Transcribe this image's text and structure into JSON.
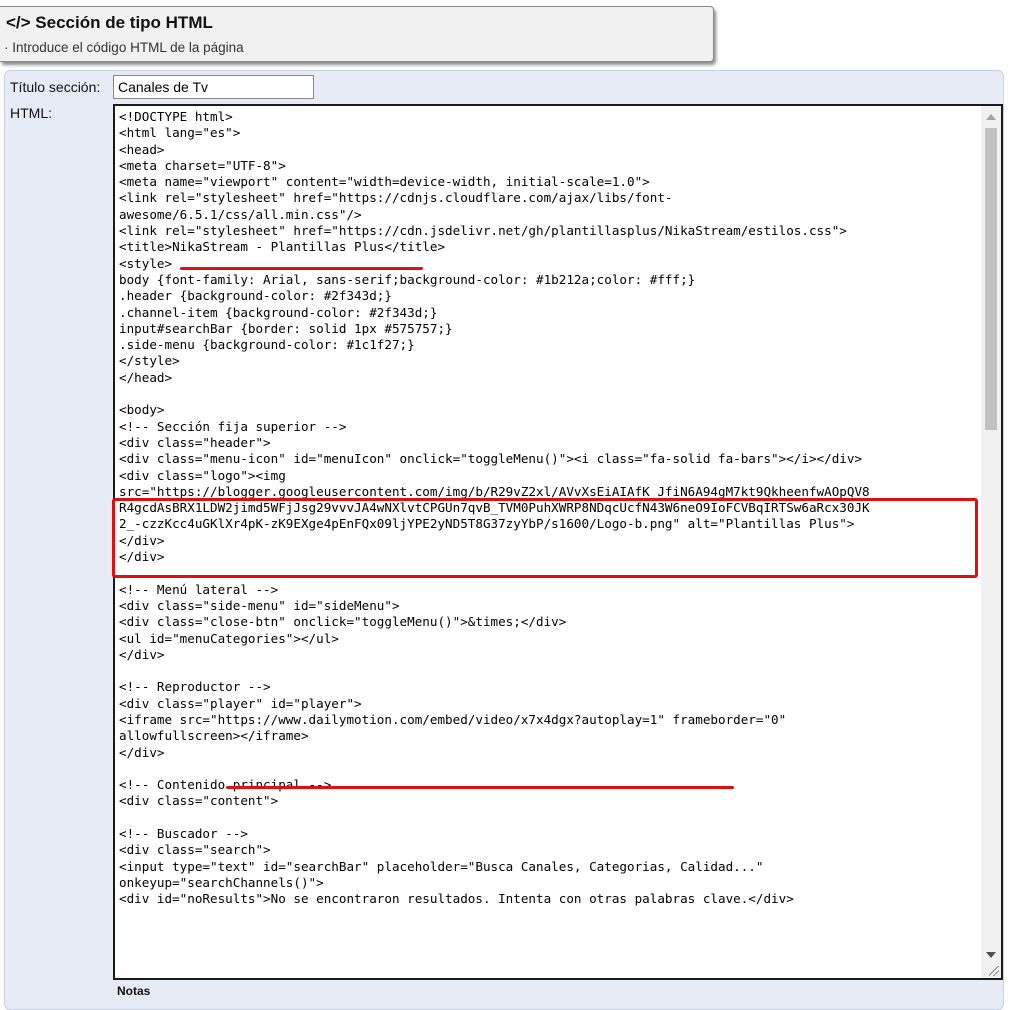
{
  "header": {
    "title": "</> Sección de tipo HTML",
    "subtitle": "· Introduce el código HTML de la página"
  },
  "form": {
    "title_label": "Título sección:",
    "title_value": "Canales de Tv",
    "html_label": "HTML:",
    "notes_label": "Notas"
  },
  "code_lines": [
    "<!DOCTYPE html>",
    "<html lang=\"es\">",
    "<head>",
    "<meta charset=\"UTF-8\">",
    "<meta name=\"viewport\" content=\"width=device-width, initial-scale=1.0\">",
    "<link rel=\"stylesheet\" href=\"https://cdnjs.cloudflare.com/ajax/libs/font-",
    "awesome/6.5.1/css/all.min.css\"/>",
    "<link rel=\"stylesheet\" href=\"https://cdn.jsdelivr.net/gh/plantillasplus/NikaStream/estilos.css\">",
    "<title>NikaStream - Plantillas Plus</title>",
    "<style>",
    "body {font-family: Arial, sans-serif;background-color: #1b212a;color: #fff;}",
    ".header {background-color: #2f343d;}",
    ".channel-item {background-color: #2f343d;}",
    "input#searchBar {border: solid 1px #575757;}",
    ".side-menu {background-color: #1c1f27;}",
    "</style>",
    "</head>",
    "",
    "<body>",
    "<!-- Sección fija superior -->",
    "<div class=\"header\">",
    "<div class=\"menu-icon\" id=\"menuIcon\" onclick=\"toggleMenu()\"><i class=\"fa-solid fa-bars\"></i></div>",
    "<div class=\"logo\"><img",
    "src=\"https://blogger.googleusercontent.com/img/b/R29vZ2xl/AVvXsEiAIAfK_JfiN6A94gM7kt9QkheenfwAOpQV8",
    "R4gcdAsBRX1LDW2jimd5WFjJsg29vvvJA4wNXlvtCPGUn7qvB_TVM0PuhXWRP8NDqcUcfN43W6neO9IoFCVBqIRTSw6aRcx30JK",
    "2_-czzKcc4uGKlXr4pK-zK9EXge4pEnFQx09ljYPE2yND5T8G37zyYbP/s1600/Logo-b.png\" alt=\"Plantillas Plus\">",
    "</div>",
    "</div>",
    "",
    "<!-- Menú lateral -->",
    "<div class=\"side-menu\" id=\"sideMenu\">",
    "<div class=\"close-btn\" onclick=\"toggleMenu()\">&times;</div>",
    "<ul id=\"menuCategories\"></ul>",
    "</div>",
    "",
    "<!-- Reproductor -->",
    "<div class=\"player\" id=\"player\">",
    "<iframe src=\"https://www.dailymotion.com/embed/video/x7x4dgx?autoplay=1\" frameborder=\"0\"",
    "allowfullscreen></iframe>",
    "</div>",
    "",
    "<!-- Contenido principal -->",
    "<div class=\"content\">",
    "",
    "<!-- Buscador -->",
    "<div class=\"search\">",
    "<input type=\"text\" id=\"searchBar\" placeholder=\"Busca Canales, Categorias, Calidad...\"",
    "onkeyup=\"searchChannels()\">",
    "<div id=\"noResults\">No se encontraron resultados. Intenta con otras palabras clave.</div>"
  ],
  "colors": {
    "annotation": "#e01010"
  }
}
